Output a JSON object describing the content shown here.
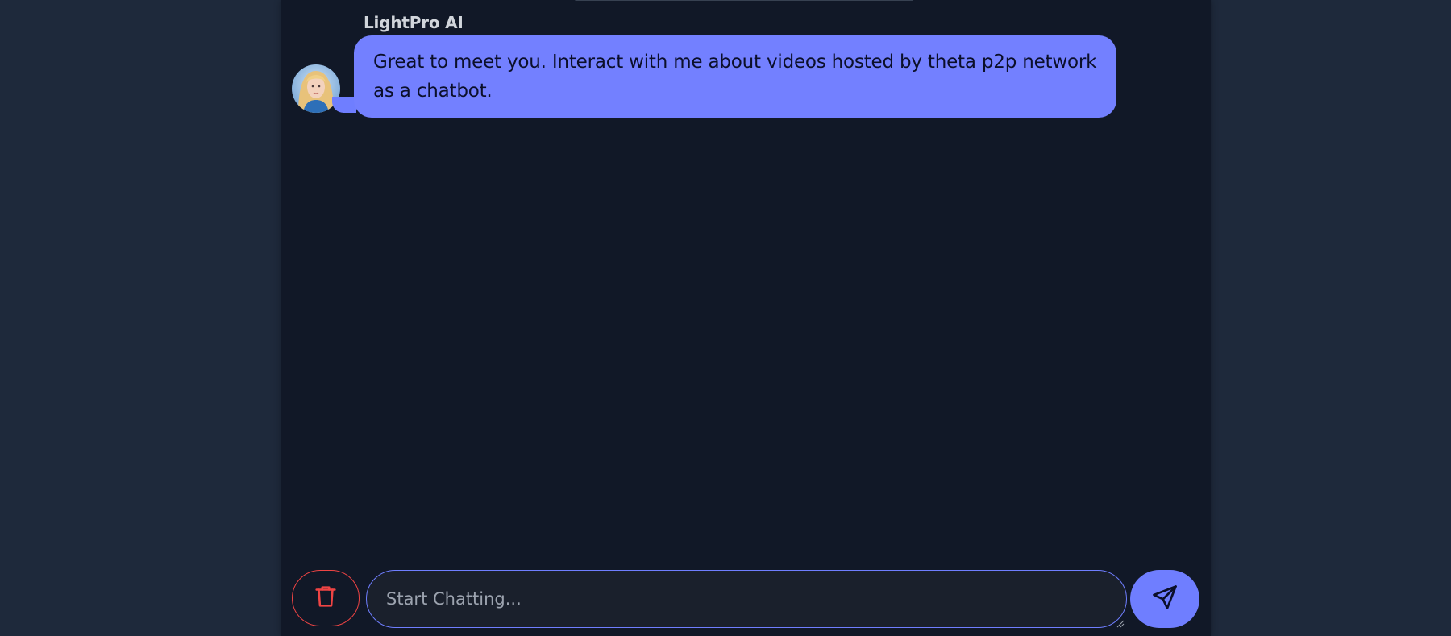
{
  "chat": {
    "sender_name": "LightPro AI",
    "message_text": "Great to meet you. Interact with me about videos hosted by theta p2p network as a chatbot."
  },
  "composer": {
    "placeholder": "Start Chatting...",
    "value": ""
  },
  "icons": {
    "delete": "trash-icon",
    "send": "send-icon",
    "avatar": "assistant-avatar"
  },
  "colors": {
    "page_background": "#1e293b",
    "panel_background": "#111827",
    "bubble": "#7380ff",
    "accent": "#6f7eff",
    "danger": "#ef4444"
  }
}
